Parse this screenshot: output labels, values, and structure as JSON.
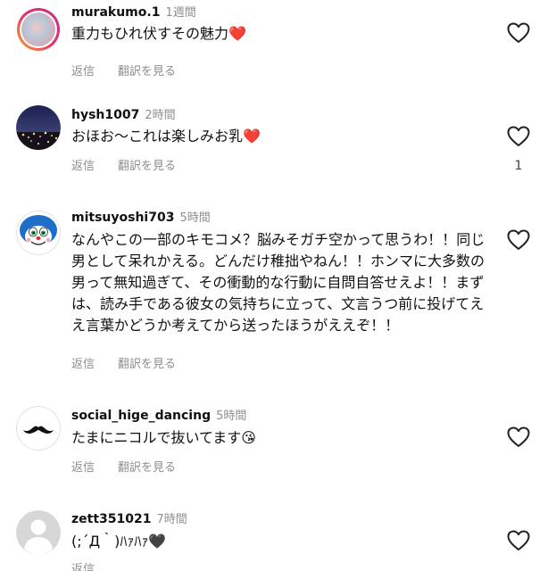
{
  "actions": {
    "reply_label": "返信",
    "translate_label": "翻訳を見る"
  },
  "comments": [
    {
      "username": "murakumo.1",
      "time": "1週間",
      "text": "重力もひれ伏すその魅力❤️"
    },
    {
      "username": "hysh1007",
      "time": "2時間",
      "text": "おほお〜これは楽しみお乳❤️",
      "likes": "1"
    },
    {
      "username": "mitsuyoshi703",
      "time": "5時間",
      "text": "なんやこの一部のキモコメ？脳みそガチ空かって思うわ！！同じ男として呆れかえる。どんだけ稚拙やねん！！ホンマに大多数の男って無知過ぎて、その衝動的な行動に自問自答せえよ！！まずは、読み手である彼女の気持ちに立って、文言うつ前に投げてええ言葉かどうか考えてから送ったほうがええぞ！！"
    },
    {
      "username": "social_hige_dancing",
      "time": "5時間",
      "text": "たまにニコルで抜いてます😘"
    },
    {
      "username": "zett351021",
      "time": "7時間",
      "text": "(;´Д｀)ﾊｧﾊｧ🖤"
    }
  ],
  "icons": {
    "like": "heart-outline-icon"
  }
}
